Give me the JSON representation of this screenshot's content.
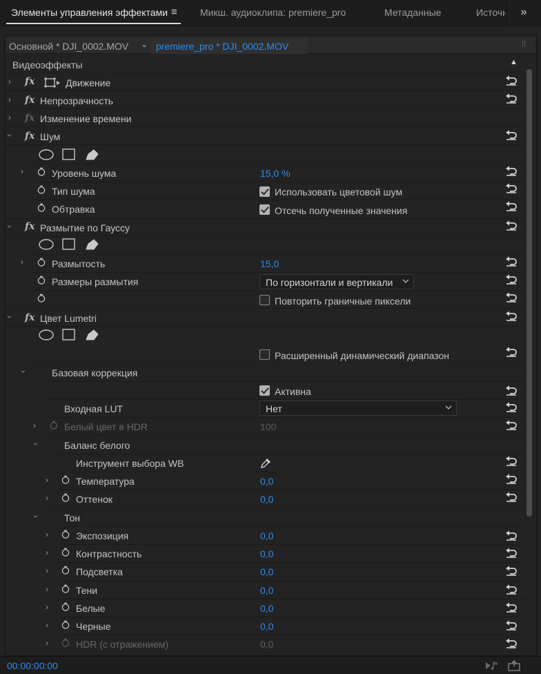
{
  "tabs": [
    {
      "label": "Элементы управления эффектами",
      "active": true
    },
    {
      "label": "Микш. аудиоклипа: premiere_pro",
      "active": false
    },
    {
      "label": "Метаданные",
      "active": false
    },
    {
      "label": "Источн",
      "active": false
    }
  ],
  "tab_menu_icon": "hamburger-icon",
  "tab_overflow_icon": "double-chevron-right-icon",
  "clip_bar": {
    "master": "Основной * DJI_0002.MOV",
    "sequence": "premiere_pro * DJI_0002.MOV"
  },
  "section_title": "Видеоэффекты",
  "effects": {
    "motion": "Движение",
    "opacity": "Непрозрачность",
    "time_remap": "Изменение времени",
    "noise": {
      "title": "Шум",
      "amount_label": "Уровень шума",
      "amount_value": "15,0 %",
      "type_label": "Тип шума",
      "type_checkbox": "Использовать цветовой шум",
      "type_checked": true,
      "clip_label": "Обтравка",
      "clip_checkbox": "Отсечь полученные значения",
      "clip_checked": true
    },
    "gauss": {
      "title": "Размытие по Гауссу",
      "blur_label": "Размытость",
      "blur_value": "15,0",
      "dims_label": "Размеры размытия",
      "dims_value": "По горизонтали и вертикали",
      "repeat_checkbox": "Повторить граничные пиксели",
      "repeat_checked": false
    },
    "lumetri": {
      "title": "Цвет Lumetri",
      "hdr_checkbox": "Расширенный динамический диапазон",
      "hdr_checked": false,
      "basic_title": "Базовая коррекция",
      "active_checkbox": "Активна",
      "active_checked": true,
      "lut_label": "Входная LUT",
      "lut_value": "Нет",
      "hdr_white_label": "Белый цвет в HDR",
      "hdr_white_value": "100",
      "wb_title": "Баланс белого",
      "wb_tool_label": "Инструмент выбора WB",
      "temp_label": "Температура",
      "temp_value": "0,0",
      "tint_label": "Оттенок",
      "tint_value": "0,0",
      "tone_title": "Тон",
      "exposure_label": "Экспозиция",
      "exposure_value": "0,0",
      "contrast_label": "Контрастность",
      "contrast_value": "0,0",
      "highlights_label": "Подсветка",
      "highlights_value": "0,0",
      "shadows_label": "Тени",
      "shadows_value": "0,0",
      "whites_label": "Белые",
      "whites_value": "0,0",
      "blacks_label": "Черные",
      "blacks_value": "0,0",
      "hdr_spec_label": "HDR (с отражением)",
      "hdr_spec_value": "0,0"
    }
  },
  "timecode": "00:00:00:00",
  "colors": {
    "accent": "#2d8ceb",
    "background": "#232323",
    "text": "#c4c4c4"
  }
}
